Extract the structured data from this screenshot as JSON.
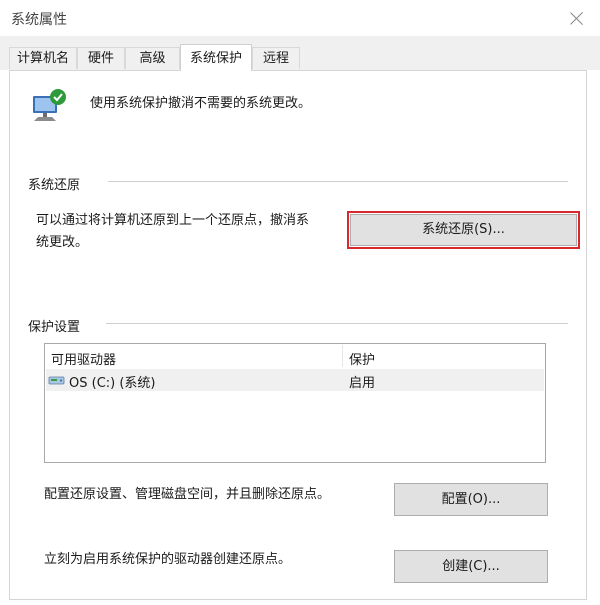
{
  "window": {
    "title": "系统属性",
    "close_icon": "close-icon"
  },
  "tabs": [
    {
      "label": "计算机名"
    },
    {
      "label": "硬件"
    },
    {
      "label": "高级"
    },
    {
      "label": "系统保护",
      "active": true
    },
    {
      "label": "远程"
    }
  ],
  "header": {
    "icon": "system-protection-icon",
    "text": "使用系统保护撤消不需要的系统更改。"
  },
  "system_restore": {
    "group_label": "系统还原",
    "description_line1": "可以通过将计算机还原到上一个还原点，撤消系",
    "description_line2": "统更改。",
    "button_label": "系统还原(S)..."
  },
  "protection_settings": {
    "group_label": "保护设置",
    "columns": [
      "可用驱动器",
      "保护"
    ],
    "drives": [
      {
        "icon": "drive-icon",
        "name": "OS (C:) (系统)",
        "protection": "启用"
      }
    ],
    "configure_text": "配置还原设置、管理磁盘空间，并且删除还原点。",
    "configure_button": "配置(O)...",
    "create_text": "立刻为启用系统保护的驱动器创建还原点。",
    "create_button": "创建(C)..."
  },
  "colors": {
    "highlight": "#d9272e",
    "button_face": "#e1e1e1",
    "selected_row": "#f0f0f0"
  }
}
